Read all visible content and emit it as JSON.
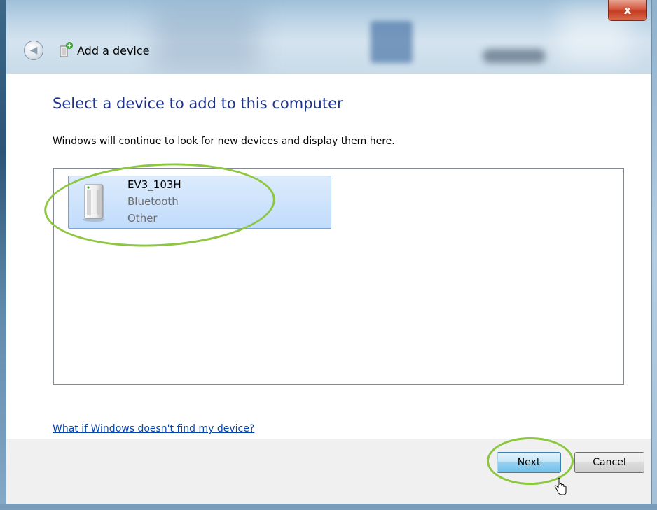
{
  "window": {
    "title": "Add a device",
    "close_label": "x"
  },
  "content": {
    "heading": "Select a device to add to this computer",
    "description": "Windows will continue to look for new devices and display them here."
  },
  "devices": [
    {
      "name": "EV3_103H",
      "type": "Bluetooth",
      "category": "Other",
      "selected": true
    }
  ],
  "help_link": "What if Windows doesn't find my device?",
  "buttons": {
    "next": "Next",
    "cancel": "Cancel"
  },
  "colors": {
    "heading": "#1e3287",
    "link": "#0645ad",
    "annotation": "#8dc63f",
    "selection": "#c1dcfc"
  },
  "icons": [
    "back-arrow-icon",
    "add-device-icon",
    "device-tower-icon",
    "close-icon",
    "mouse-cursor-icon"
  ]
}
